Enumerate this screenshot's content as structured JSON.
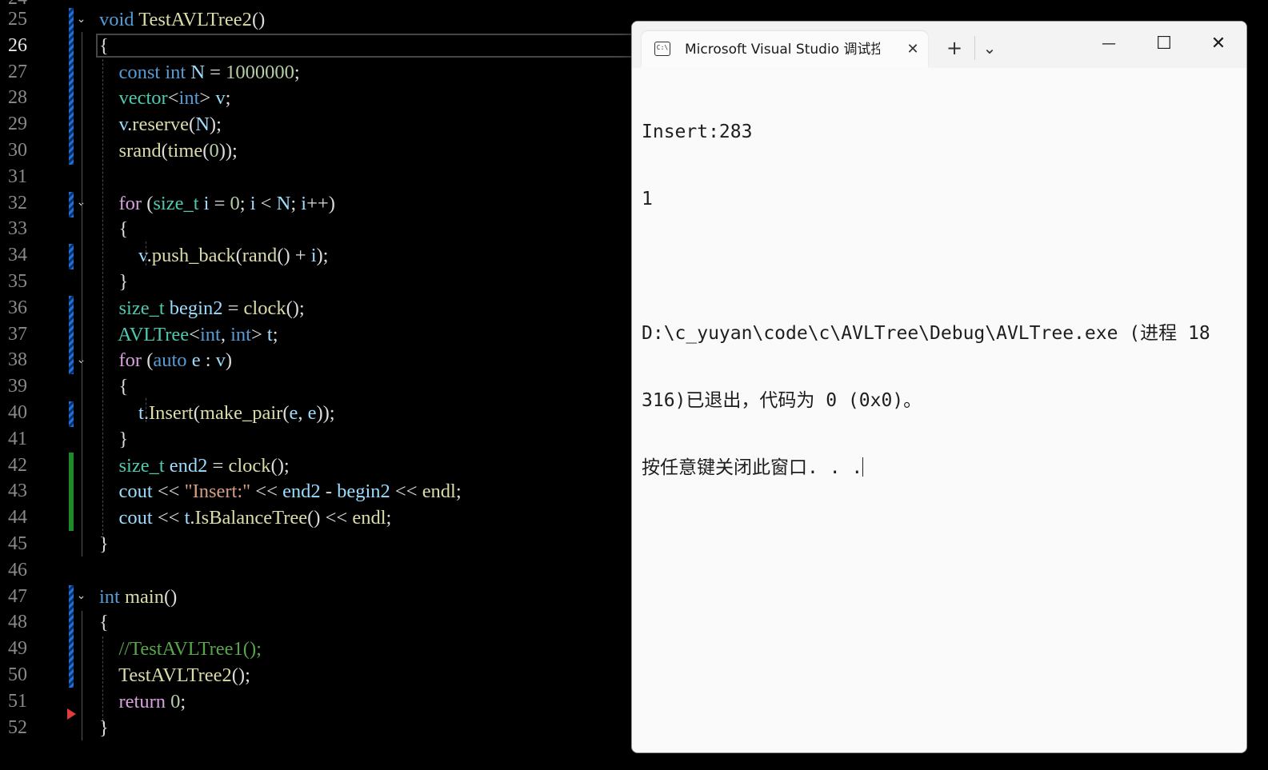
{
  "editor": {
    "top_partial_line_number": "24",
    "lines": [
      {
        "n": "25",
        "code": [
          [
            "kw",
            "void"
          ],
          [
            "p",
            " "
          ],
          [
            "fn",
            "TestAVLTree2"
          ],
          [
            "p",
            "()"
          ]
        ]
      },
      {
        "n": "26",
        "code": [
          [
            "p",
            "{"
          ]
        ]
      },
      {
        "n": "27",
        "code": [
          [
            "p",
            "    "
          ],
          [
            "kw",
            "const"
          ],
          [
            "p",
            " "
          ],
          [
            "kw",
            "int"
          ],
          [
            "p",
            " "
          ],
          [
            "va",
            "N"
          ],
          [
            "p",
            " = "
          ],
          [
            "num",
            "1000000"
          ],
          [
            "p",
            ";"
          ]
        ]
      },
      {
        "n": "28",
        "code": [
          [
            "p",
            "    "
          ],
          [
            "ty",
            "vector"
          ],
          [
            "p",
            "<"
          ],
          [
            "kw",
            "int"
          ],
          [
            "p",
            "> "
          ],
          [
            "va",
            "v"
          ],
          [
            "p",
            ";"
          ]
        ]
      },
      {
        "n": "29",
        "code": [
          [
            "p",
            "    "
          ],
          [
            "va",
            "v"
          ],
          [
            "p",
            "."
          ],
          [
            "fn",
            "reserve"
          ],
          [
            "p",
            "("
          ],
          [
            "va",
            "N"
          ],
          [
            "p",
            ");"
          ]
        ]
      },
      {
        "n": "30",
        "code": [
          [
            "p",
            "    "
          ],
          [
            "fn",
            "srand"
          ],
          [
            "p",
            "("
          ],
          [
            "fn",
            "time"
          ],
          [
            "p",
            "("
          ],
          [
            "num",
            "0"
          ],
          [
            "p",
            "));"
          ]
        ]
      },
      {
        "n": "31",
        "code": []
      },
      {
        "n": "32",
        "code": [
          [
            "p",
            "    "
          ],
          [
            "fl",
            "for"
          ],
          [
            "p",
            " ("
          ],
          [
            "ty",
            "size_t"
          ],
          [
            "p",
            " "
          ],
          [
            "va",
            "i"
          ],
          [
            "p",
            " = "
          ],
          [
            "num",
            "0"
          ],
          [
            "p",
            "; "
          ],
          [
            "va",
            "i"
          ],
          [
            "p",
            " < "
          ],
          [
            "va",
            "N"
          ],
          [
            "p",
            "; "
          ],
          [
            "va",
            "i"
          ],
          [
            "p",
            "++)"
          ]
        ]
      },
      {
        "n": "33",
        "code": [
          [
            "p",
            "    {"
          ]
        ]
      },
      {
        "n": "34",
        "code": [
          [
            "p",
            "        "
          ],
          [
            "va",
            "v"
          ],
          [
            "p",
            "."
          ],
          [
            "fn",
            "push_back"
          ],
          [
            "p",
            "("
          ],
          [
            "fn",
            "rand"
          ],
          [
            "p",
            "() + "
          ],
          [
            "va",
            "i"
          ],
          [
            "p",
            ");"
          ]
        ]
      },
      {
        "n": "35",
        "code": [
          [
            "p",
            "    }"
          ]
        ]
      },
      {
        "n": "36",
        "code": [
          [
            "p",
            "    "
          ],
          [
            "ty",
            "size_t"
          ],
          [
            "p",
            " "
          ],
          [
            "va",
            "begin2"
          ],
          [
            "p",
            " = "
          ],
          [
            "fn",
            "clock"
          ],
          [
            "p",
            "();"
          ]
        ]
      },
      {
        "n": "37",
        "code": [
          [
            "p",
            "    "
          ],
          [
            "ty",
            "AVLTree"
          ],
          [
            "p",
            "<"
          ],
          [
            "kw",
            "int"
          ],
          [
            "p",
            ", "
          ],
          [
            "kw",
            "int"
          ],
          [
            "p",
            "> "
          ],
          [
            "va",
            "t"
          ],
          [
            "p",
            ";"
          ]
        ]
      },
      {
        "n": "38",
        "code": [
          [
            "p",
            "    "
          ],
          [
            "fl",
            "for"
          ],
          [
            "p",
            " ("
          ],
          [
            "kw",
            "auto"
          ],
          [
            "p",
            " "
          ],
          [
            "va",
            "e"
          ],
          [
            "p",
            " : "
          ],
          [
            "va",
            "v"
          ],
          [
            "p",
            ")"
          ]
        ]
      },
      {
        "n": "39",
        "code": [
          [
            "p",
            "    {"
          ]
        ]
      },
      {
        "n": "40",
        "code": [
          [
            "p",
            "        "
          ],
          [
            "va",
            "t"
          ],
          [
            "p",
            "."
          ],
          [
            "fn",
            "Insert"
          ],
          [
            "p",
            "("
          ],
          [
            "fn",
            "make_pair"
          ],
          [
            "p",
            "("
          ],
          [
            "va",
            "e"
          ],
          [
            "p",
            ", "
          ],
          [
            "va",
            "e"
          ],
          [
            "p",
            "));"
          ]
        ]
      },
      {
        "n": "41",
        "code": [
          [
            "p",
            "    }"
          ]
        ]
      },
      {
        "n": "42",
        "code": [
          [
            "p",
            "    "
          ],
          [
            "ty",
            "size_t"
          ],
          [
            "p",
            " "
          ],
          [
            "va",
            "end2"
          ],
          [
            "p",
            " = "
          ],
          [
            "fn",
            "clock"
          ],
          [
            "p",
            "();"
          ]
        ]
      },
      {
        "n": "43",
        "code": [
          [
            "p",
            "    "
          ],
          [
            "va",
            "cout"
          ],
          [
            "p",
            " << "
          ],
          [
            "str",
            "\"Insert:\""
          ],
          [
            "p",
            " << "
          ],
          [
            "va",
            "end2"
          ],
          [
            "p",
            " - "
          ],
          [
            "va",
            "begin2"
          ],
          [
            "p",
            " << "
          ],
          [
            "fn",
            "endl"
          ],
          [
            "p",
            ";"
          ]
        ]
      },
      {
        "n": "44",
        "code": [
          [
            "p",
            "    "
          ],
          [
            "va",
            "cout"
          ],
          [
            "p",
            " << "
          ],
          [
            "va",
            "t"
          ],
          [
            "p",
            "."
          ],
          [
            "fn",
            "IsBalanceTree"
          ],
          [
            "p",
            "() << "
          ],
          [
            "fn",
            "endl"
          ],
          [
            "p",
            ";"
          ]
        ]
      },
      {
        "n": "45",
        "code": [
          [
            "p",
            "}"
          ]
        ]
      },
      {
        "n": "46",
        "code": []
      },
      {
        "n": "47",
        "code": [
          [
            "kw",
            "int"
          ],
          [
            "p",
            " "
          ],
          [
            "fn",
            "main"
          ],
          [
            "p",
            "()"
          ]
        ]
      },
      {
        "n": "48",
        "code": [
          [
            "p",
            "{"
          ]
        ]
      },
      {
        "n": "49",
        "code": [
          [
            "p",
            "    "
          ],
          [
            "cm",
            "//TestAVLTree1();"
          ]
        ]
      },
      {
        "n": "50",
        "code": [
          [
            "p",
            "    "
          ],
          [
            "fn",
            "TestAVLTree2"
          ],
          [
            "p",
            "();"
          ]
        ]
      },
      {
        "n": "51",
        "code": [
          [
            "p",
            "    "
          ],
          [
            "fl",
            "return"
          ],
          [
            "p",
            " "
          ],
          [
            "num",
            "0"
          ],
          [
            "p",
            ";"
          ]
        ]
      },
      {
        "n": "52",
        "code": [
          [
            "p",
            "}"
          ]
        ]
      }
    ],
    "current_line": "26",
    "colors": {
      "keyword": "#569cd6",
      "flow": "#d8a0df",
      "type": "#4ec9b0",
      "function": "#dcdcaa",
      "variable": "#9cdcfe",
      "number": "#b5cea8",
      "string": "#d69d85",
      "comment": "#57a64a",
      "changed_marker": "#1f6fd8",
      "saved_marker": "#1e8a2a",
      "breakpoint_arrow": "#e03c3c"
    }
  },
  "console": {
    "tab_title": "Microsoft Visual Studio 调试控",
    "tab_icon": "terminal-icon",
    "tab_icon_text": "C:\\",
    "tab_close": "✕",
    "new_tab": "+",
    "dropdown": "⌄",
    "minimize": "—",
    "maximize": "☐",
    "close": "✕",
    "output": [
      "Insert:283",
      "1",
      "",
      "D:\\c_yuyan\\code\\c\\AVLTree\\Debug\\AVLTree.exe (进程 18",
      "316)已退出，代码为 0 (0x0)。",
      "按任意键关闭此窗口. . ."
    ]
  }
}
